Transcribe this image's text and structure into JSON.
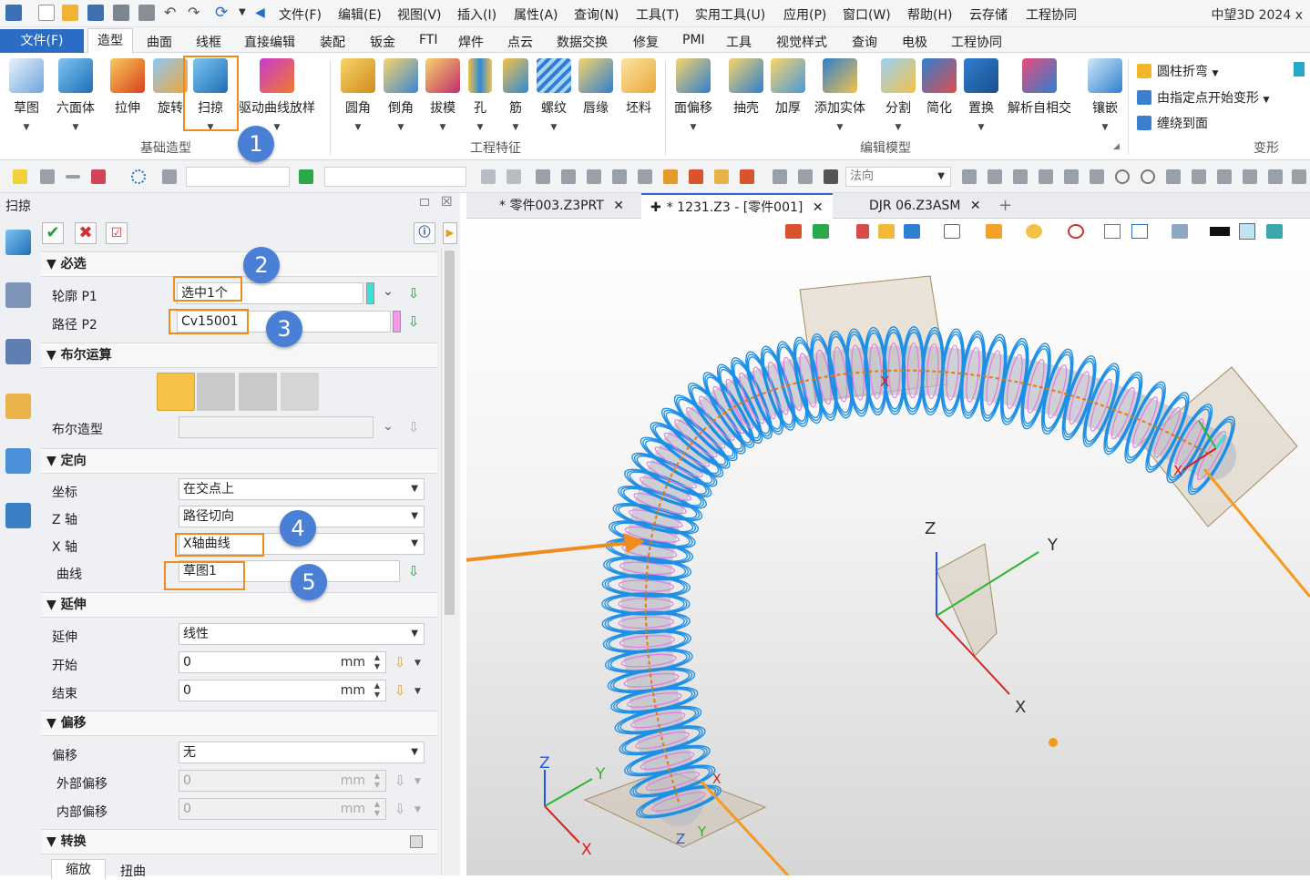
{
  "app_title": "中望3D 2024 x",
  "menu": [
    "文件(F)",
    "编辑(E)",
    "视图(V)",
    "插入(I)",
    "属性(A)",
    "查询(N)",
    "工具(T)",
    "实用工具(U)",
    "应用(P)",
    "窗口(W)",
    "帮助(H)",
    "云存储",
    "工程协同"
  ],
  "file_tab": "文件(F)",
  "ribbon_tabs": [
    "造型",
    "曲面",
    "线框",
    "直接编辑",
    "装配",
    "钣金",
    "FTI",
    "焊件",
    "点云",
    "数据交换",
    "修复",
    "PMI",
    "工具",
    "视觉样式",
    "查询",
    "电极",
    "工程协同"
  ],
  "ribbon": {
    "basic": {
      "label": "基础造型",
      "buttons": [
        "草图",
        "六面体",
        "拉伸",
        "旋转",
        "扫掠",
        "驱动曲线放样"
      ]
    },
    "eng": {
      "label": "工程特征",
      "buttons": [
        "圆角",
        "倒角",
        "拔模",
        "孔",
        "筋",
        "螺纹",
        "唇缘",
        "坯料"
      ]
    },
    "edit": {
      "label": "编辑模型",
      "buttons": [
        "面偏移",
        "抽壳",
        "加厚",
        "添加实体",
        "分割",
        "简化",
        "置换",
        "解析自相交",
        "镶嵌"
      ]
    },
    "deform": {
      "label": "变形",
      "items": [
        "圆柱折弯",
        "由指定点开始变形",
        "缠绕到面"
      ]
    }
  },
  "toolbar2": {
    "normal_combo": "法向"
  },
  "panel": {
    "title": "扫掠",
    "sections": {
      "required": "必选",
      "boolean": "布尔运算",
      "orient": "定向",
      "extend": "延伸",
      "offset": "偏移",
      "transform": "转换"
    },
    "required": {
      "profile_label": "轮廓 P1",
      "profile_value": "选中1个",
      "path_label": "路径 P2",
      "path_value": "Cv15001"
    },
    "boolean": {
      "shape_label": "布尔造型"
    },
    "orient": {
      "coord_label": "坐标",
      "coord_value": "在交点上",
      "z_label": "Z 轴",
      "z_value": "路径切向",
      "x_label": "X 轴",
      "x_value": "X轴曲线",
      "curve_label": "曲线",
      "curve_value": "草图1"
    },
    "extend": {
      "type_label": "延伸",
      "type_value": "线性",
      "start_label": "开始",
      "start_value": "0",
      "end_label": "结束",
      "end_value": "0",
      "unit": "mm"
    },
    "offset": {
      "type_label": "偏移",
      "type_value": "无",
      "outer_label": "外部偏移",
      "outer_value": "0",
      "inner_label": "内部偏移",
      "inner_value": "0",
      "unit": "mm"
    },
    "transform_tabs": [
      "缩放",
      "扭曲"
    ]
  },
  "badges": [
    "1",
    "2",
    "3",
    "4",
    "5"
  ],
  "doc_tabs": [
    "* 零件003.Z3PRT",
    "* 1231.Z3 - [零件001]",
    "DJR 06.Z3ASM"
  ],
  "viewport": {
    "axis_x": "X",
    "axis_y": "Y",
    "axis_z": "Z"
  },
  "colors": {
    "accent": "#2b6cc4",
    "highlight": "#f08c1e",
    "badge": "#4a7fd6",
    "spring": "#1e8fe6",
    "profile": "#e37be0"
  }
}
